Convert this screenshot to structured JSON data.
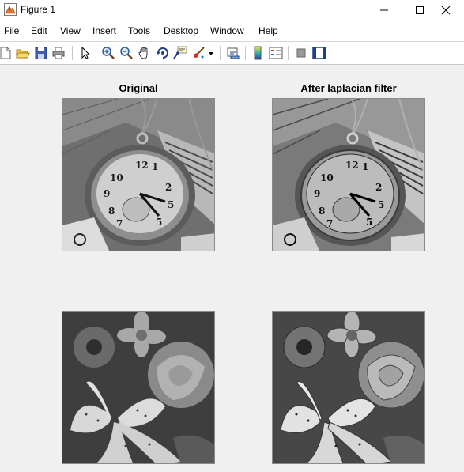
{
  "window": {
    "title": "Figure 1"
  },
  "menu": [
    "File",
    "Edit",
    "View",
    "Insert",
    "Tools",
    "Desktop",
    "Window",
    "Help"
  ],
  "toolbar": {
    "icons": [
      "new-figure-icon",
      "open-file-icon",
      "save-icon",
      "print-icon",
      "edit-plot-icon",
      "zoom-in-icon",
      "zoom-out-icon",
      "pan-icon",
      "rotate-3d-icon",
      "data-cursor-icon",
      "brush-icon",
      "link-plot-icon",
      "colorbar-icon",
      "legend-icon",
      "hide-plot-tools-icon",
      "show-plot-tools-icon"
    ]
  },
  "axes": [
    {
      "title": "Original"
    },
    {
      "title": "After laplacian filter"
    },
    {
      "title": ""
    },
    {
      "title": ""
    }
  ],
  "images": [
    {
      "subject": "pocket watch",
      "filtered": false
    },
    {
      "subject": "pocket watch",
      "filtered": true
    },
    {
      "subject": "flowers",
      "filtered": false
    },
    {
      "subject": "flowers",
      "filtered": true
    }
  ]
}
